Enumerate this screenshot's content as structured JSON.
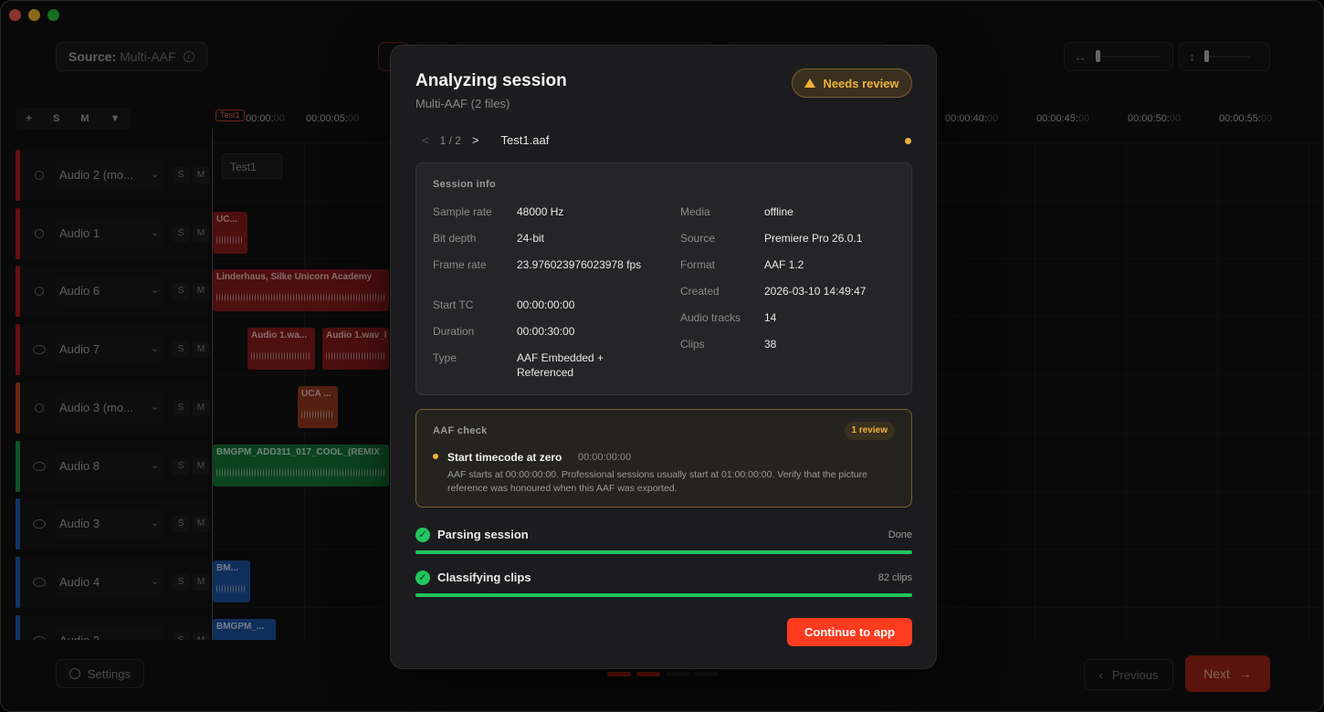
{
  "topbar": {
    "source_label": "Source:",
    "source_value": "Multi-AAF"
  },
  "track_tools": [
    "+",
    "S",
    "M",
    "▼"
  ],
  "ruler": {
    "badge": "Test1",
    "ticks": [
      {
        "main": "00:00:",
        "dim": "00"
      },
      {
        "main": "00:00:05:",
        "dim": "00"
      },
      {
        "main": "00:00:40:",
        "dim": "00"
      },
      {
        "main": "00:00:45:",
        "dim": "00"
      },
      {
        "main": "00:00:50:",
        "dim": "00"
      },
      {
        "main": "00:00:55:",
        "dim": "00"
      }
    ]
  },
  "tracks": [
    {
      "name": "Audio 2 (mo...",
      "color": "#b81c1c",
      "linked": false
    },
    {
      "name": "Audio 1",
      "color": "#b81c1c",
      "linked": false
    },
    {
      "name": "Audio 6",
      "color": "#b81c1c",
      "linked": false
    },
    {
      "name": "Audio 7",
      "color": "#b81c1c",
      "linked": true
    },
    {
      "name": "Audio 3 (mo...",
      "color": "#c2461f",
      "linked": false
    },
    {
      "name": "Audio 8",
      "color": "#1b9a45",
      "linked": true
    },
    {
      "name": "Audio 3",
      "color": "#1d5fbf",
      "linked": true
    },
    {
      "name": "Audio 4",
      "color": "#1d5fbf",
      "linked": true
    },
    {
      "name": "Audio 2",
      "color": "#1d5fbf",
      "linked": true
    }
  ],
  "track_buttons": {
    "solo": "S",
    "mute": "M"
  },
  "clips": {
    "ghost": "Test1",
    "c1": "UC...",
    "c2": "Linderhaus, Silke Unicorn Academy",
    "c3": "Audio 1.wa...",
    "c4": "Audio 1.wav_l",
    "c5": "UCA ...",
    "c6": "BMGPM_ADD311_017_COOL_(REMIX",
    "c7": "BM...",
    "c8": "BMGPM_..."
  },
  "bottom": {
    "settings": "Settings",
    "previous": "Previous",
    "next": "Next"
  },
  "modal": {
    "title": "Analyzing session",
    "subtitle": "Multi-AAF (2 files)",
    "badge": "Needs review",
    "file_nav": {
      "position": "1 / 2",
      "file": "Test1.aaf"
    },
    "session_info": {
      "heading": "Session info",
      "left": [
        {
          "k": "Sample rate",
          "v": "48000 Hz"
        },
        {
          "k": "Bit depth",
          "v": "24-bit"
        },
        {
          "k": "Frame rate",
          "v": "23.976023976023978 fps"
        },
        {
          "k": "Start TC",
          "v": "00:00:00:00"
        },
        {
          "k": "Duration",
          "v": "00:00:30:00"
        },
        {
          "k": "Type",
          "v": "AAF Embedded + Referenced"
        }
      ],
      "right": [
        {
          "k": "Media",
          "v": "offline"
        },
        {
          "k": "Source",
          "v": "Premiere Pro 26.0.1"
        },
        {
          "k": "Format",
          "v": "AAF 1.2"
        },
        {
          "k": "Created",
          "v": "2026-03-10 14:49:47"
        },
        {
          "k": "Audio tracks",
          "v": "14"
        },
        {
          "k": "Clips",
          "v": "38"
        }
      ]
    },
    "aaf_check": {
      "heading": "AAF check",
      "badge": "1 review",
      "item_title": "Start timecode at zero",
      "item_tc": "00:00:00:00",
      "item_desc": "AAF starts at 00:00:00:00. Professional sessions usually start at 01:00:00:00. Verify that the picture reference was honoured when this AAF was exported."
    },
    "progress": [
      {
        "label": "Parsing session",
        "status": "Done",
        "percent": 100
      },
      {
        "label": "Classifying clips",
        "status": "82 clips",
        "percent": 100
      }
    ],
    "continue": "Continue to app"
  }
}
